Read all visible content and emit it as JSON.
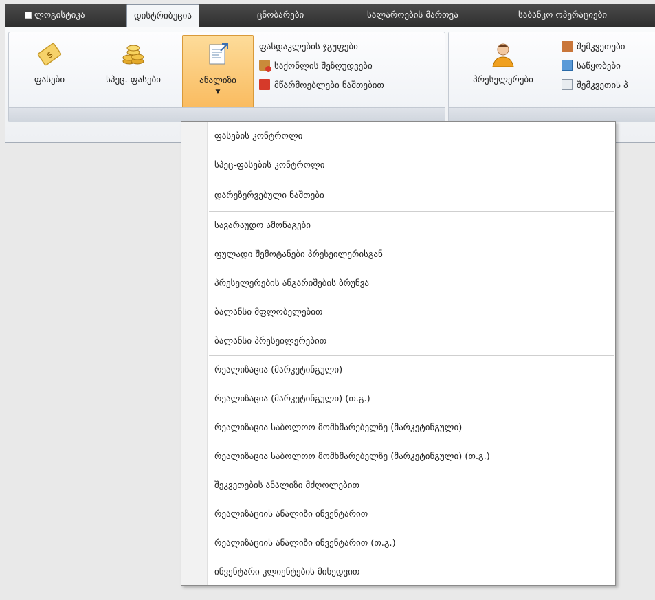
{
  "tabs": [
    {
      "label": "ლოგისტიკა"
    },
    {
      "label": "დისტრიბუცია"
    },
    {
      "label": "ცნობარები"
    },
    {
      "label": "სალაროების მართვა"
    },
    {
      "label": "საბანკო ოპერაციები"
    }
  ],
  "ribbon": {
    "prices": "ფასები",
    "special_prices": "სპეც. ფასები",
    "analysis": "ანალიზი",
    "price_groups": "ფასდაკლების ჯგუფები",
    "goods_restrictions": "საქონლის შეზღუდვები",
    "producers_balance": "მწარმოებლები ნაშთებით",
    "presellers": "პრესელერები",
    "buyers": "შემკვეთები",
    "warehouses": "საწყობები",
    "buyer_cards": "შემკვეთის პ"
  },
  "menu": {
    "items": [
      "ფასების კონტროლი",
      "სპეც-ფასების კონტროლი",
      "დარეზერვებული ნაშთები",
      "სავარაუდო ამონაგები",
      "ფულადი შემოტანები პრესეილერისგან",
      "პრესელერების ანგარიშების ბრუნვა",
      "ბალანსი მფლობელებით",
      "ბალანსი პრესეილერებით",
      "რეალიზაცია (მარკეტინგული)",
      "რეალიზაცია (მარკეტინგული) (თ.გ.)",
      "რეალიზაცია საბოლოო მომხმარებელზე (მარკეტინგული)",
      "რეალიზაცია საბოლოო მომხმარებელზე (მარკეტინგული) (თ.გ.)",
      "შეკვეთების ანალიზი მძღოლებით",
      "რეალიზაციის ანალიზი ინვენტარით",
      "რეალიზაციის ანალიზი ინვენტარით (თ.გ.)",
      "ინვენტარი კლიენტების მიხედვით"
    ]
  },
  "colors": {
    "tabbar": "#3a3a3a",
    "pressed": "#f9b85a",
    "ribbon": "#eef0f3"
  }
}
